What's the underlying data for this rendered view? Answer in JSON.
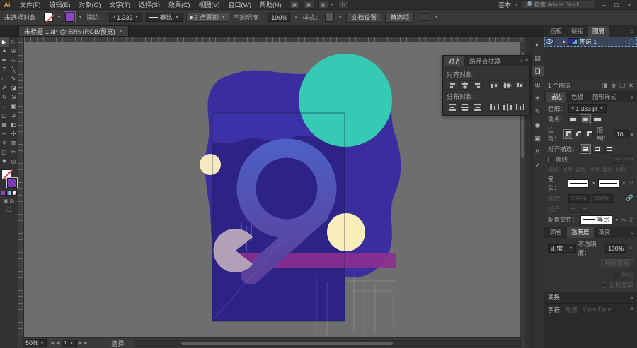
{
  "menu_bar": {
    "logo": "Ai",
    "items": [
      "文件(F)",
      "编辑(E)",
      "对象(O)",
      "文字(T)",
      "选择(S)",
      "效果(C)",
      "视图(V)",
      "窗口(W)",
      "帮助(H)"
    ],
    "workspace": "基本",
    "search_placeholder": "搜索 Adobe Stock",
    "window_controls": {
      "minimize": "‒",
      "maximize": "□",
      "close": "×"
    }
  },
  "control_bar": {
    "status": "未选择对象",
    "stroke_label": "描边：",
    "stroke_value": "1.333",
    "profile_value": "等比",
    "brush_value": "5 点圆形",
    "opacity_label": "不透明度：",
    "opacity_value": "100%",
    "style_label": "样式：",
    "doc_setup": "文档设置",
    "preferences": "首选项"
  },
  "document_tab": {
    "title": "未标题-1.ai* @ 50% (RGB/预览)",
    "close": "×"
  },
  "toolbar": {
    "tools": [
      {
        "name": "selection-tool",
        "glyph": "▶",
        "cls": "active"
      },
      {
        "name": "direct-selection-tool",
        "glyph": "▷"
      },
      {
        "name": "magic-wand-tool",
        "glyph": "✦"
      },
      {
        "name": "lasso-tool",
        "glyph": "✇"
      },
      {
        "name": "pen-tool",
        "glyph": "✒"
      },
      {
        "name": "curvature-tool",
        "glyph": "∿"
      },
      {
        "name": "type-tool",
        "glyph": "T"
      },
      {
        "name": "line-segment-tool",
        "glyph": "╲"
      },
      {
        "name": "rectangle-tool",
        "glyph": "▭"
      },
      {
        "name": "paintbrush-tool",
        "glyph": "✎"
      },
      {
        "name": "pencil-tool",
        "glyph": "✐"
      },
      {
        "name": "eraser-tool",
        "glyph": "◪"
      },
      {
        "name": "rotate-tool",
        "glyph": "↻"
      },
      {
        "name": "scale-tool",
        "glyph": "⇲"
      },
      {
        "name": "width-tool",
        "glyph": "↔"
      },
      {
        "name": "free-transform-tool",
        "glyph": "▣"
      },
      {
        "name": "shape-builder-tool",
        "glyph": "◫"
      },
      {
        "name": "perspective-grid-tool",
        "glyph": "⊿"
      },
      {
        "name": "mesh-tool",
        "glyph": "▦"
      },
      {
        "name": "gradient-tool",
        "glyph": "◧"
      },
      {
        "name": "eyedropper-tool",
        "glyph": "✑"
      },
      {
        "name": "blend-tool",
        "glyph": "✣"
      },
      {
        "name": "symbol-sprayer-tool",
        "glyph": "✳"
      },
      {
        "name": "column-graph-tool",
        "glyph": "▥"
      },
      {
        "name": "artboard-tool",
        "glyph": "▢"
      },
      {
        "name": "slice-tool",
        "glyph": "✂"
      },
      {
        "name": "hand-tool",
        "glyph": "✱"
      },
      {
        "name": "zoom-tool",
        "glyph": "◎"
      }
    ]
  },
  "align_panel": {
    "tabs": [
      "对齐",
      "路径查找器"
    ],
    "align_label": "对齐对象：",
    "distribute_label": "分布对象："
  },
  "dock_strip": {
    "icons": [
      {
        "name": "color-panel-icon",
        "glyph": "◐"
      },
      {
        "name": "swatches-panel-icon",
        "glyph": "▤"
      },
      {
        "name": "layers-panel-icon",
        "glyph": "❏",
        "cls": "active"
      },
      {
        "name": "artboards-panel-icon",
        "glyph": "⊞"
      },
      {
        "name": "symbols-panel-icon",
        "glyph": "✳"
      },
      {
        "name": "brushes-panel-icon",
        "glyph": "✎"
      },
      {
        "name": "appearance-panel-icon",
        "glyph": "◉"
      },
      {
        "name": "graphic-styles-panel-icon",
        "glyph": "▣"
      },
      {
        "name": "character-panel-icon",
        "glyph": "A"
      },
      {
        "name": "export-panel-icon",
        "glyph": "↗"
      }
    ]
  },
  "layers_panel": {
    "tabs": [
      "画板",
      "链接",
      "图层"
    ],
    "layer_name": "图层 1",
    "footer": "1 个图层"
  },
  "stroke_panel": {
    "tabs": [
      "描边",
      "色板",
      "图形样式"
    ],
    "weight_label": "粗细：",
    "weight_value": "1.333 pt",
    "cap_label": "端点：",
    "corner_label": "边角：",
    "limit_label": "限制：",
    "limit_value": "10",
    "limit_unit": "x",
    "align_stroke_label": "对齐描边：",
    "dash_label": "虚线",
    "dash_cols": [
      "虚线",
      "间隙",
      "虚线",
      "间隙",
      "虚线",
      "间隙"
    ],
    "arrow_label": "箭头：",
    "swap_glyph": "⇄",
    "scale_label": "缩放：",
    "scale_values": [
      "100%",
      "100%"
    ],
    "align_label": "对齐：",
    "profile_label": "配置文件：",
    "profile_value": "等比"
  },
  "transparency_panel": {
    "tabs": [
      "颜色",
      "透明度",
      "渐变"
    ],
    "blend_mode": "正常",
    "opacity_label": "不透明度：",
    "opacity_value": "100%",
    "make_mask": "制作蒙版",
    "clip_label": "剪切",
    "invert_label": "反相蒙版"
  },
  "transform_panel": {
    "title": "变换"
  },
  "type_panels": {
    "tabs": [
      "字符",
      "段落",
      "OpenType"
    ]
  },
  "status_bar": {
    "zoom": "50%",
    "artboard_nav": "1",
    "tool_hint": "选择"
  },
  "colors": {
    "canvas": "#6e6e6e",
    "blob": "#3a2d9f",
    "rect": "#2d2387",
    "wave": "#3d31a8",
    "teal": "#36cab5",
    "cream_small": "#f6e9c2",
    "cream_medium": "#f9edb9",
    "pacman": "#b2a1b9",
    "magenta": "#8e2d92",
    "ring_top": "#4d5fc4",
    "ring_bottom": "#5b3e97",
    "fill_swatch": "#8e44c8"
  }
}
